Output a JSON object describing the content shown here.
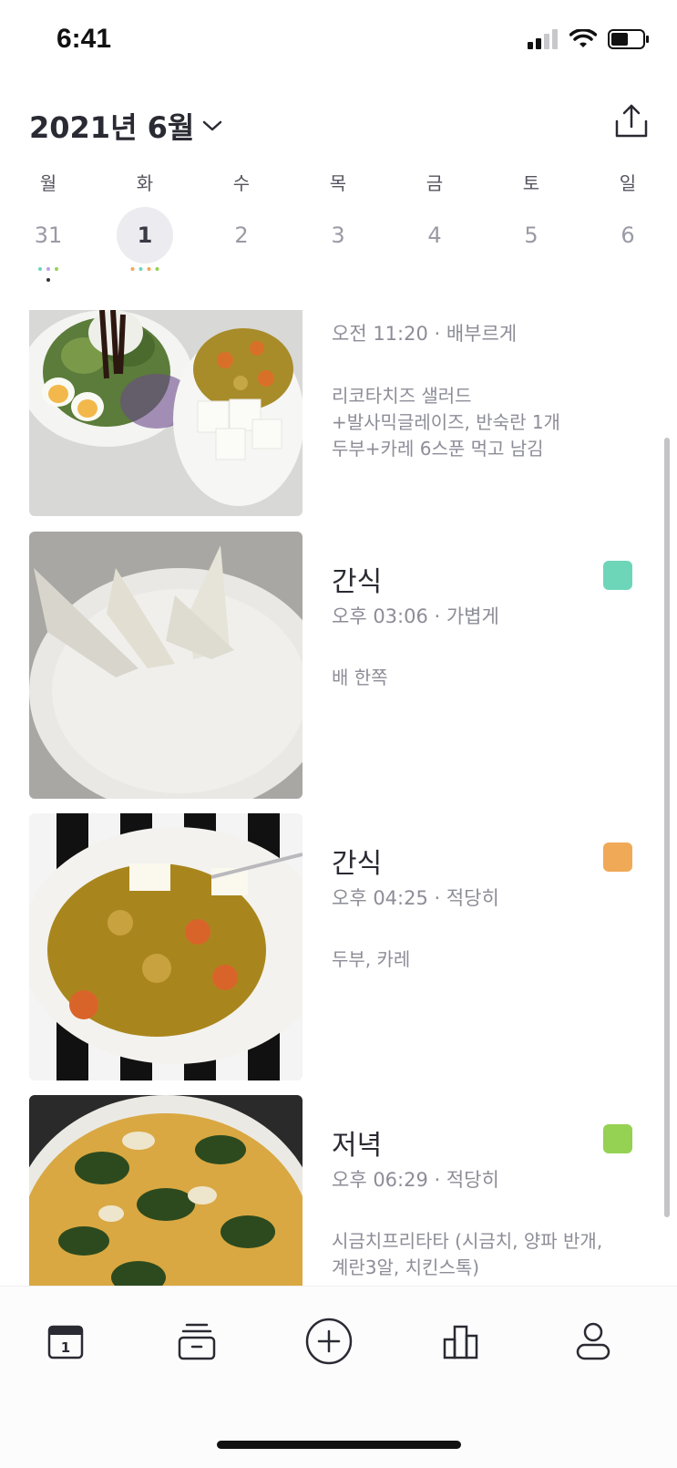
{
  "status_bar": {
    "time": "6:41"
  },
  "header": {
    "month_title": "2021년 6월"
  },
  "week": {
    "weekdays": [
      "월",
      "화",
      "수",
      "목",
      "금",
      "토",
      "일"
    ],
    "dates": [
      "31",
      "1",
      "2",
      "3",
      "4",
      "5",
      "6"
    ],
    "selected_index": 1
  },
  "entries": [
    {
      "title": "",
      "meta": "오전 11:20 · 배부르게",
      "note_lines": [
        "리코타치즈 샐러드",
        "+발사믹글레이즈, 반숙란 1개",
        "두부+카레 6스푼 먹고 남김"
      ],
      "tag_color": ""
    },
    {
      "title": "간식",
      "meta": "오후 03:06 · 가볍게",
      "note_lines": [
        "배 한쪽"
      ],
      "tag_color": "#6ed6b8"
    },
    {
      "title": "간식",
      "meta": "오후 04:25 · 적당히",
      "note_lines": [
        "두부, 카레"
      ],
      "tag_color": "#f0a957"
    },
    {
      "title": "저녁",
      "meta": "오후 06:29 · 적당히",
      "note_lines": [
        "시금치프리타타 (시금치, 양파 반개,",
        "계란3알, 치킨스톡)"
      ],
      "tag_color": "#95d153"
    }
  ],
  "tabbar": {
    "tabs": [
      "calendar-icon",
      "archive-box-icon",
      "add-circle-icon",
      "bar-chart-icon",
      "profile-icon"
    ],
    "calendar_day": "1"
  },
  "colors": {
    "dot_green": "#6ed6b8",
    "dot_orange": "#f0a957",
    "dot_lime": "#95d153",
    "dot_purple": "#b7a4e6",
    "dot_dark": "#333333"
  }
}
